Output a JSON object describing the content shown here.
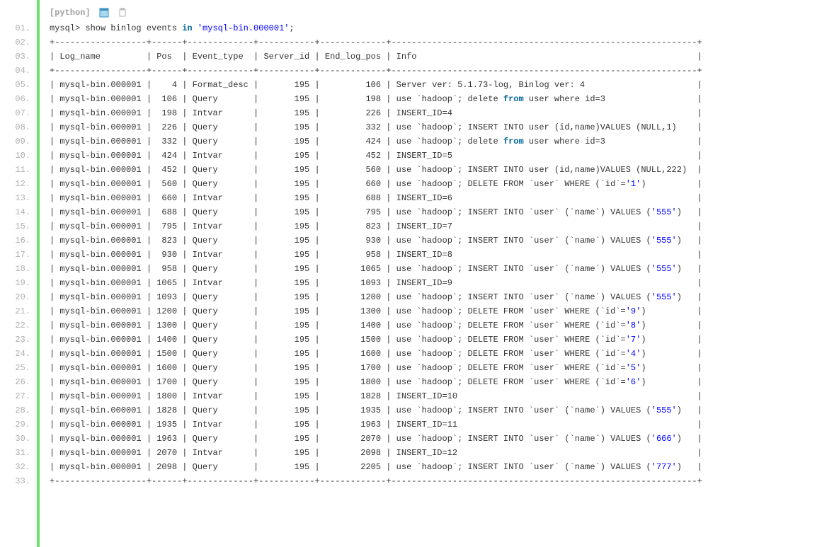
{
  "language": "[python]",
  "command": {
    "prefix": "mysql> show binlog events ",
    "kw": "in",
    "str": "'mysql-bin.000001'",
    "suffix": ";"
  },
  "sep": "+------------------+------+-------------+-----------+-------------+------------------------------------------------------------+",
  "header": "| Log_name         | Pos  | Event_type  | Server_id | End_log_pos | Info                                                       |",
  "rows": [
    {
      "log": "mysql-bin.000001",
      "pos": "4",
      "type": "Format_desc",
      "sid": "195",
      "end": "106",
      "info": [
        {
          "t": "Server ver: 5.1.73-log, Binlog ver: 4"
        }
      ]
    },
    {
      "log": "mysql-bin.000001",
      "pos": "106",
      "type": "Query",
      "sid": "195",
      "end": "198",
      "info": [
        {
          "t": "use `hadoop`; delete "
        },
        {
          "t": "from",
          "k": 1
        },
        {
          "t": " user where id=3"
        }
      ]
    },
    {
      "log": "mysql-bin.000001",
      "pos": "198",
      "type": "Intvar",
      "sid": "195",
      "end": "226",
      "info": [
        {
          "t": "INSERT_ID=4"
        }
      ]
    },
    {
      "log": "mysql-bin.000001",
      "pos": "226",
      "type": "Query",
      "sid": "195",
      "end": "332",
      "info": [
        {
          "t": "use `hadoop`; INSERT INTO user (id,name)VALUES (NULL,1)"
        }
      ]
    },
    {
      "log": "mysql-bin.000001",
      "pos": "332",
      "type": "Query",
      "sid": "195",
      "end": "424",
      "info": [
        {
          "t": "use `hadoop`; delete "
        },
        {
          "t": "from",
          "k": 1
        },
        {
          "t": " user where id=3"
        }
      ]
    },
    {
      "log": "mysql-bin.000001",
      "pos": "424",
      "type": "Intvar",
      "sid": "195",
      "end": "452",
      "info": [
        {
          "t": "INSERT_ID=5"
        }
      ]
    },
    {
      "log": "mysql-bin.000001",
      "pos": "452",
      "type": "Query",
      "sid": "195",
      "end": "560",
      "info": [
        {
          "t": "use `hadoop`; INSERT INTO user (id,name)VALUES (NULL,222)"
        }
      ]
    },
    {
      "log": "mysql-bin.000001",
      "pos": "560",
      "type": "Query",
      "sid": "195",
      "end": "660",
      "info": [
        {
          "t": "use `hadoop`; DELETE FROM `user` WHERE (`id`="
        },
        {
          "t": "'1'",
          "s": 1
        },
        {
          "t": ")"
        }
      ]
    },
    {
      "log": "mysql-bin.000001",
      "pos": "660",
      "type": "Intvar",
      "sid": "195",
      "end": "688",
      "info": [
        {
          "t": "INSERT_ID=6"
        }
      ]
    },
    {
      "log": "mysql-bin.000001",
      "pos": "688",
      "type": "Query",
      "sid": "195",
      "end": "795",
      "info": [
        {
          "t": "use `hadoop`; INSERT INTO `user` (`name`) VALUES ("
        },
        {
          "t": "'555'",
          "s": 1
        },
        {
          "t": ")"
        }
      ]
    },
    {
      "log": "mysql-bin.000001",
      "pos": "795",
      "type": "Intvar",
      "sid": "195",
      "end": "823",
      "info": [
        {
          "t": "INSERT_ID=7"
        }
      ]
    },
    {
      "log": "mysql-bin.000001",
      "pos": "823",
      "type": "Query",
      "sid": "195",
      "end": "930",
      "info": [
        {
          "t": "use `hadoop`; INSERT INTO `user` (`name`) VALUES ("
        },
        {
          "t": "'555'",
          "s": 1
        },
        {
          "t": ")"
        }
      ]
    },
    {
      "log": "mysql-bin.000001",
      "pos": "930",
      "type": "Intvar",
      "sid": "195",
      "end": "958",
      "info": [
        {
          "t": "INSERT_ID=8"
        }
      ]
    },
    {
      "log": "mysql-bin.000001",
      "pos": "958",
      "type": "Query",
      "sid": "195",
      "end": "1065",
      "info": [
        {
          "t": "use `hadoop`; INSERT INTO `user` (`name`) VALUES ("
        },
        {
          "t": "'555'",
          "s": 1
        },
        {
          "t": ")"
        }
      ]
    },
    {
      "log": "mysql-bin.000001",
      "pos": "1065",
      "type": "Intvar",
      "sid": "195",
      "end": "1093",
      "info": [
        {
          "t": "INSERT_ID=9"
        }
      ]
    },
    {
      "log": "mysql-bin.000001",
      "pos": "1093",
      "type": "Query",
      "sid": "195",
      "end": "1200",
      "info": [
        {
          "t": "use `hadoop`; INSERT INTO `user` (`name`) VALUES ("
        },
        {
          "t": "'555'",
          "s": 1
        },
        {
          "t": ")"
        }
      ]
    },
    {
      "log": "mysql-bin.000001",
      "pos": "1200",
      "type": "Query",
      "sid": "195",
      "end": "1300",
      "info": [
        {
          "t": "use `hadoop`; DELETE FROM `user` WHERE (`id`="
        },
        {
          "t": "'9'",
          "s": 1
        },
        {
          "t": ")"
        }
      ]
    },
    {
      "log": "mysql-bin.000001",
      "pos": "1300",
      "type": "Query",
      "sid": "195",
      "end": "1400",
      "info": [
        {
          "t": "use `hadoop`; DELETE FROM `user` WHERE (`id`="
        },
        {
          "t": "'8'",
          "s": 1
        },
        {
          "t": ")"
        }
      ]
    },
    {
      "log": "mysql-bin.000001",
      "pos": "1400",
      "type": "Query",
      "sid": "195",
      "end": "1500",
      "info": [
        {
          "t": "use `hadoop`; DELETE FROM `user` WHERE (`id`="
        },
        {
          "t": "'7'",
          "s": 1
        },
        {
          "t": ")"
        }
      ]
    },
    {
      "log": "mysql-bin.000001",
      "pos": "1500",
      "type": "Query",
      "sid": "195",
      "end": "1600",
      "info": [
        {
          "t": "use `hadoop`; DELETE FROM `user` WHERE (`id`="
        },
        {
          "t": "'4'",
          "s": 1
        },
        {
          "t": ")"
        }
      ]
    },
    {
      "log": "mysql-bin.000001",
      "pos": "1600",
      "type": "Query",
      "sid": "195",
      "end": "1700",
      "info": [
        {
          "t": "use `hadoop`; DELETE FROM `user` WHERE (`id`="
        },
        {
          "t": "'5'",
          "s": 1
        },
        {
          "t": ")"
        }
      ]
    },
    {
      "log": "mysql-bin.000001",
      "pos": "1700",
      "type": "Query",
      "sid": "195",
      "end": "1800",
      "info": [
        {
          "t": "use `hadoop`; DELETE FROM `user` WHERE (`id`="
        },
        {
          "t": "'6'",
          "s": 1
        },
        {
          "t": ")"
        }
      ]
    },
    {
      "log": "mysql-bin.000001",
      "pos": "1800",
      "type": "Intvar",
      "sid": "195",
      "end": "1828",
      "info": [
        {
          "t": "INSERT_ID=10"
        }
      ]
    },
    {
      "log": "mysql-bin.000001",
      "pos": "1828",
      "type": "Query",
      "sid": "195",
      "end": "1935",
      "info": [
        {
          "t": "use `hadoop`; INSERT INTO `user` (`name`) VALUES ("
        },
        {
          "t": "'555'",
          "s": 1
        },
        {
          "t": ")"
        }
      ]
    },
    {
      "log": "mysql-bin.000001",
      "pos": "1935",
      "type": "Intvar",
      "sid": "195",
      "end": "1963",
      "info": [
        {
          "t": "INSERT_ID=11"
        }
      ]
    },
    {
      "log": "mysql-bin.000001",
      "pos": "1963",
      "type": "Query",
      "sid": "195",
      "end": "2070",
      "info": [
        {
          "t": "use `hadoop`; INSERT INTO `user` (`name`) VALUES ("
        },
        {
          "t": "'666'",
          "s": 1
        },
        {
          "t": ")"
        }
      ]
    },
    {
      "log": "mysql-bin.000001",
      "pos": "2070",
      "type": "Intvar",
      "sid": "195",
      "end": "2098",
      "info": [
        {
          "t": "INSERT_ID=12"
        }
      ]
    },
    {
      "log": "mysql-bin.000001",
      "pos": "2098",
      "type": "Query",
      "sid": "195",
      "end": "2205",
      "info": [
        {
          "t": "use `hadoop`; INSERT INTO `user` (`name`) VALUES ("
        },
        {
          "t": "'777'",
          "s": 1
        },
        {
          "t": ")"
        }
      ]
    }
  ],
  "line_count": 33
}
